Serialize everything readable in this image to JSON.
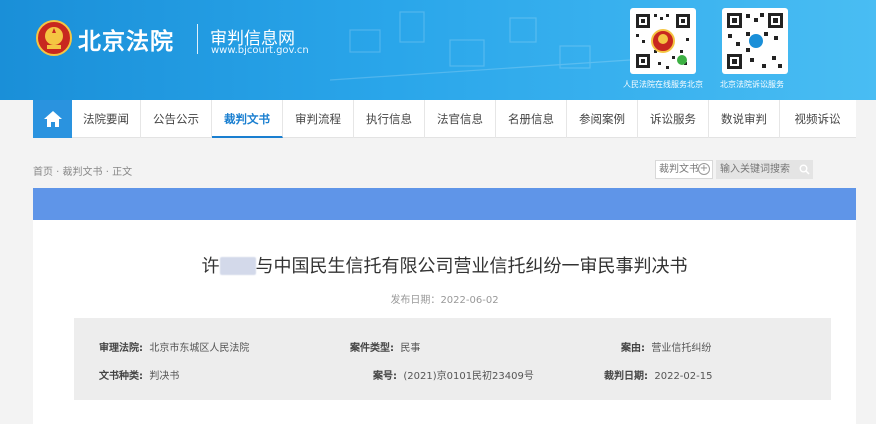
{
  "header": {
    "site_name": "北京法院",
    "subsite_name": "审判信息网",
    "subsite_url": "www.bjcourt.gov.cn",
    "qr_codes": [
      {
        "caption": "人民法院在线服务北京",
        "icon": "court-emblem-qr"
      },
      {
        "caption": "北京法院诉讼服务",
        "icon": "wechat-qr"
      }
    ],
    "colors": {
      "header_start": "#1a8fd8",
      "header_end": "#49bdf3",
      "accent": "#1a7fd0",
      "band": "#5f95e8"
    }
  },
  "nav": {
    "home_icon": "home-icon",
    "items": [
      {
        "label": "法院要闻"
      },
      {
        "label": "公告公示"
      },
      {
        "label": "裁判文书",
        "active": true
      },
      {
        "label": "审判流程"
      },
      {
        "label": "执行信息"
      },
      {
        "label": "法官信息"
      },
      {
        "label": "名册信息"
      },
      {
        "label": "参阅案例"
      },
      {
        "label": "诉讼服务"
      },
      {
        "label": "数说审判"
      },
      {
        "label": "视频诉讼"
      }
    ]
  },
  "breadcrumb": "首页 · 裁判文书 · 正文",
  "search": {
    "type_label": "裁判文书",
    "placeholder": "输入关键词搜索"
  },
  "document": {
    "title_prefix": "许",
    "title_suffix": "与中国民生信托有限公司营业信托纠纷一审民事判决书",
    "publish_label": "发布日期：",
    "publish_date": "2022-06-02",
    "meta": {
      "court_label": "审理法院:",
      "court": "北京市东城区人民法院",
      "case_type_label": "案件类型:",
      "case_type": "民事",
      "cause_label": "案由:",
      "cause": "营业信托纠纷",
      "doc_type_label": "文书种类:",
      "doc_type": "判决书",
      "case_no_label": "案号:",
      "case_no": "(2021)京0101民初23409号",
      "judge_date_label": "裁判日期:",
      "judge_date": "2022-02-15"
    }
  }
}
